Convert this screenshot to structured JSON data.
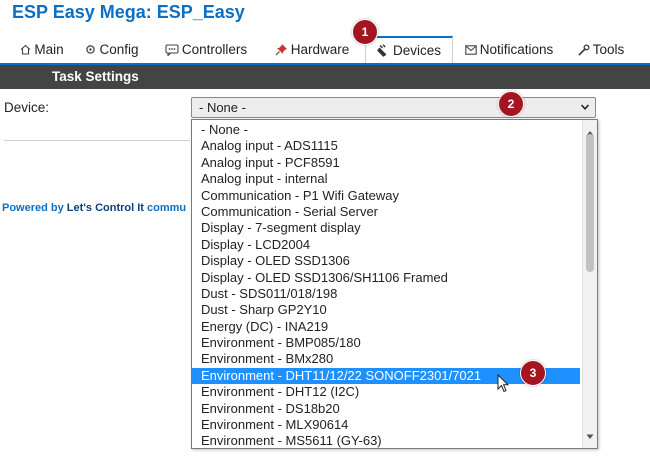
{
  "app": {
    "title": "ESP Easy Mega: ESP_Easy"
  },
  "tabs": [
    {
      "label": "Main",
      "icon": "home-icon"
    },
    {
      "label": "Config",
      "icon": "gear-icon"
    },
    {
      "label": "Controllers",
      "icon": "chat-icon"
    },
    {
      "label": "Hardware",
      "icon": "pushpin-icon"
    },
    {
      "label": "Devices",
      "icon": "plug-icon",
      "active": true
    },
    {
      "label": "Notifications",
      "icon": "envelope-icon"
    },
    {
      "label": "Tools",
      "icon": "wrench-icon"
    }
  ],
  "section": {
    "title": "Task Settings"
  },
  "form": {
    "device_label": "Device:",
    "selected_value": "- None -"
  },
  "dropdown": {
    "options": [
      "- None -",
      "Analog input - ADS1115",
      "Analog input - PCF8591",
      "Analog input - internal",
      "Communication - P1 Wifi Gateway",
      "Communication - Serial Server",
      "Display - 7-segment display",
      "Display - LCD2004",
      "Display - OLED SSD1306",
      "Display - OLED SSD1306/SH1106 Framed",
      "Dust - SDS011/018/198",
      "Dust - Sharp GP2Y10",
      "Energy (DC) - INA219",
      "Environment - BMP085/180",
      "Environment - BMx280",
      "Environment - DHT11/12/22 SONOFF2301/7021",
      "Environment - DHT12 (I2C)",
      "Environment - DS18b20",
      "Environment - MLX90614",
      "Environment - MS5611 (GY-63)"
    ],
    "highlighted_index": 15
  },
  "footer": {
    "powered_prefix": "Powered by ",
    "brand": "Let's Control It",
    "suffix": " commu"
  },
  "annotations": [
    "1",
    "2",
    "3"
  ],
  "colors": {
    "accent": "#0c6fc3",
    "section_bar": "#444444",
    "highlight": "#1e90ff",
    "badge": "#a31621"
  }
}
